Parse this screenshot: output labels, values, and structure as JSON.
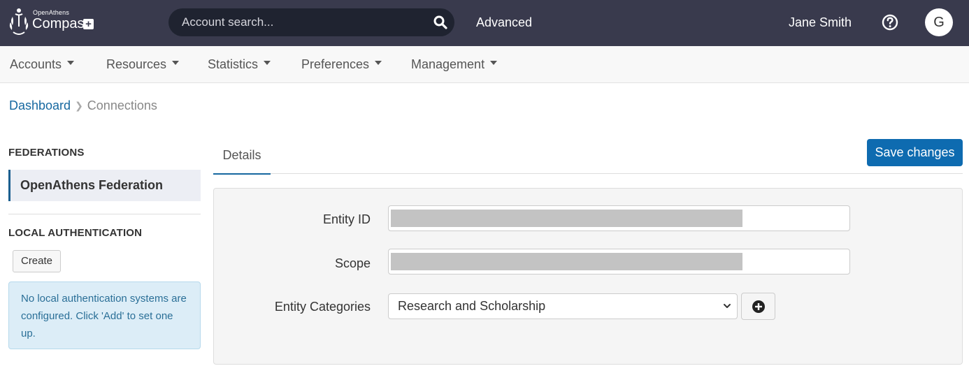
{
  "header": {
    "brand_small": "OpenAthens",
    "brand_main": "Compass",
    "search": {
      "placeholder": "Account search...",
      "value": "",
      "icon": "search-icon"
    },
    "advanced_label": "Advanced",
    "user_name": "Jane Smith",
    "help_icon": "help-icon",
    "avatar_initial": "G",
    "bg_color": "#393a4d"
  },
  "nav": {
    "items": [
      {
        "label": "Accounts"
      },
      {
        "label": "Resources"
      },
      {
        "label": "Statistics"
      },
      {
        "label": "Preferences"
      },
      {
        "label": "Management"
      }
    ]
  },
  "breadcrumb": {
    "home": "Dashboard",
    "current": "Connections"
  },
  "sidebar": {
    "federations_heading": "FEDERATIONS",
    "federation_item": "OpenAthens Federation",
    "local_auth_heading": "LOCAL AUTHENTICATION",
    "create_label": "Create",
    "info_message": "No local authentication systems are configured. Click 'Add' to set one up."
  },
  "main": {
    "tab_details": "Details",
    "save_label": "Save changes",
    "accent_color": "#0e6bb0",
    "fields": {
      "entity_id_label": "Entity ID",
      "scope_label": "Scope",
      "entity_categories_label": "Entity Categories",
      "entity_categories_value": "Research and Scholarship"
    }
  }
}
